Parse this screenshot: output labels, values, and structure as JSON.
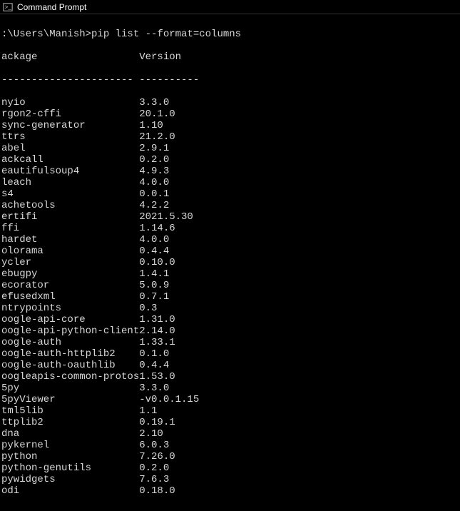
{
  "window": {
    "title": "Command Prompt"
  },
  "terminal": {
    "prompt": ":\\Users\\Manish>pip list --format=columns",
    "header_package": "ackage",
    "header_version": "Version",
    "sep_package": "----------------------",
    "sep_version": "----------",
    "packages": [
      {
        "name": "nyio",
        "version": "3.3.0"
      },
      {
        "name": "rgon2-cffi",
        "version": "20.1.0"
      },
      {
        "name": "sync-generator",
        "version": "1.10"
      },
      {
        "name": "ttrs",
        "version": "21.2.0"
      },
      {
        "name": "abel",
        "version": "2.9.1"
      },
      {
        "name": "ackcall",
        "version": "0.2.0"
      },
      {
        "name": "eautifulsoup4",
        "version": "4.9.3"
      },
      {
        "name": "leach",
        "version": "4.0.0"
      },
      {
        "name": "s4",
        "version": "0.0.1"
      },
      {
        "name": "achetools",
        "version": "4.2.2"
      },
      {
        "name": "ertifi",
        "version": "2021.5.30"
      },
      {
        "name": "ffi",
        "version": "1.14.6"
      },
      {
        "name": "hardet",
        "version": "4.0.0"
      },
      {
        "name": "olorama",
        "version": "0.4.4"
      },
      {
        "name": "ycler",
        "version": "0.10.0"
      },
      {
        "name": "ebugpy",
        "version": "1.4.1"
      },
      {
        "name": "ecorator",
        "version": "5.0.9"
      },
      {
        "name": "efusedxml",
        "version": "0.7.1"
      },
      {
        "name": "ntrypoints",
        "version": "0.3"
      },
      {
        "name": "oogle-api-core",
        "version": "1.31.0"
      },
      {
        "name": "oogle-api-python-client",
        "version": "2.14.0"
      },
      {
        "name": "oogle-auth",
        "version": "1.33.1"
      },
      {
        "name": "oogle-auth-httplib2",
        "version": "0.1.0"
      },
      {
        "name": "oogle-auth-oauthlib",
        "version": "0.4.4"
      },
      {
        "name": "oogleapis-common-protos",
        "version": "1.53.0"
      },
      {
        "name": "5py",
        "version": "3.3.0"
      },
      {
        "name": "5pyViewer",
        "version": "-v0.0.1.15"
      },
      {
        "name": "tml5lib",
        "version": "1.1"
      },
      {
        "name": "ttplib2",
        "version": "0.19.1"
      },
      {
        "name": "dna",
        "version": "2.10"
      },
      {
        "name": "pykernel",
        "version": "6.0.3"
      },
      {
        "name": "python",
        "version": "7.26.0"
      },
      {
        "name": "python-genutils",
        "version": "0.2.0"
      },
      {
        "name": "pywidgets",
        "version": "7.6.3"
      },
      {
        "name": "odi",
        "version": "0.18.0"
      }
    ]
  }
}
